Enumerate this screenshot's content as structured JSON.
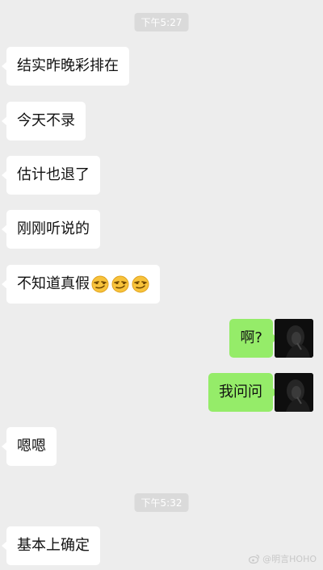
{
  "timestamps": [
    "下午5:27",
    "下午5:32"
  ],
  "messages": [
    {
      "side": "left",
      "text": "结实昨晚彩排在"
    },
    {
      "side": "left",
      "text": "今天不录"
    },
    {
      "side": "left",
      "text": "估计也退了"
    },
    {
      "side": "left",
      "text": "刚刚听说的"
    },
    {
      "side": "left",
      "text": "不知道真假",
      "emoji": [
        "smirk-emoji",
        "smirk-emoji",
        "smirk-emoji"
      ]
    },
    {
      "side": "right",
      "text": "啊?"
    },
    {
      "side": "right",
      "text": "我问问"
    },
    {
      "side": "left",
      "text": "嗯嗯"
    },
    {
      "side": "left",
      "text": "基本上确定"
    }
  ],
  "watermark": "@明言HOHO",
  "colors": {
    "background": "#ededed",
    "incoming_bubble": "#ffffff",
    "outgoing_bubble": "#95ec69",
    "timestamp_bg": "#dadada"
  }
}
